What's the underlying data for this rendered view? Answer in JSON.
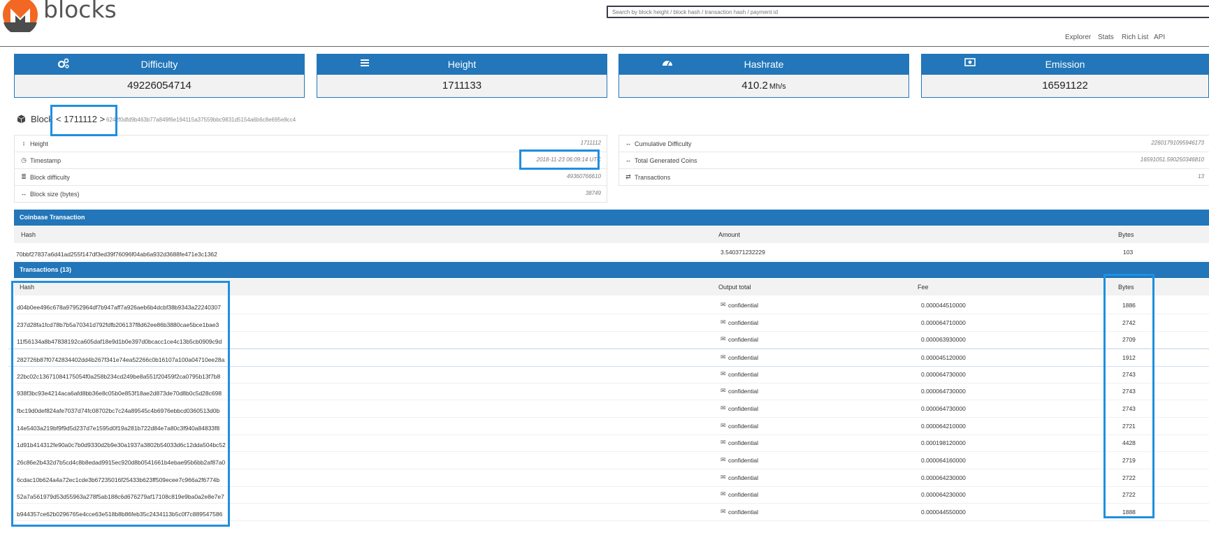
{
  "header": {
    "logo_text": "blocks",
    "search_placeholder": "Search by block height / block hash / transaction hash / payment id",
    "nav": [
      "Explorer",
      "Stats",
      "Rich List",
      "API"
    ]
  },
  "stats": [
    {
      "label": "Difficulty",
      "value": "49226054714",
      "unit": "",
      "icon": "gears-icon"
    },
    {
      "label": "Height",
      "value": "1711133",
      "unit": "",
      "icon": "bars-icon"
    },
    {
      "label": "Hashrate",
      "value": "410.2",
      "unit": "Mh/s",
      "icon": "dashboard-icon"
    },
    {
      "label": "Emission",
      "value": "16591122",
      "unit": "",
      "icon": "money-icon"
    }
  ],
  "block": {
    "label": "Block",
    "prev": "<",
    "number": "1711112",
    "next": ">",
    "hash": "6242f0dfd9b463b77a849f6e194115a37559bbc9831d5154a6b6c8e695e8cc4"
  },
  "info_left": [
    {
      "label": "Height",
      "value": "1711112",
      "icon": "vertical-arrows-icon"
    },
    {
      "label": "Timestamp",
      "value": "2018-11-23 06:09:14 UTC",
      "icon": "clock-icon"
    },
    {
      "label": "Block difficulty",
      "value": "49360766610",
      "icon": "database-icon"
    },
    {
      "label": "Block size (bytes)",
      "value": "38749",
      "icon": "horizontal-arrows-icon"
    }
  ],
  "info_right": [
    {
      "label": "Cumulative Difficulty",
      "value": "22601791095946173",
      "icon": "horizontal-arrows-icon"
    },
    {
      "label": "Total Generated Coins",
      "value": "16591051.590250346810",
      "icon": "horizontal-arrows-icon"
    },
    {
      "label": "Transactions",
      "value": "13",
      "icon": "exchange-icon"
    }
  ],
  "coinbase": {
    "title": "Coinbase Transaction",
    "headers": {
      "hash": "Hash",
      "amount": "Amount",
      "bytes": "Bytes"
    },
    "row": {
      "hash": "70bbf27837a6d41ad255f147df3ed39f76096f04ab6a932d3688fe471e3c1362",
      "amount": "3.540371232229",
      "bytes": "103"
    }
  },
  "transactions": {
    "title": "Transactions (13)",
    "headers": {
      "hash": "Hash",
      "output": "Output total",
      "fee": "Fee",
      "bytes": "Bytes"
    },
    "rows": [
      {
        "hash": "d04b0ee496c678a97952964df7b947aff7a926aeb6b4dcbf38b9343a22240307",
        "output": "confidential",
        "fee": "0.000044510000",
        "bytes": "1886"
      },
      {
        "hash": "237d28fa1fcd78b7b5a70341d792fdfb206137f8d62ee86b3880cae5bce1bae3",
        "output": "confidential",
        "fee": "0.000064710000",
        "bytes": "2742"
      },
      {
        "hash": "11f56134a8b47838192ca605daf18e9d1b0e397d0bcacc1ce4c13b5cb0909c9d",
        "output": "confidential",
        "fee": "0.000063930000",
        "bytes": "2709"
      },
      {
        "hash": "282726b87f0742834402dd4b267f341e74ea52266c0b16107a100a04710ee28a",
        "output": "confidential",
        "fee": "0.000045120000",
        "bytes": "1912"
      },
      {
        "hash": "22bc02c13671084175054f0a258b234cd249be8a551f20459f2ca0795b13f7b8",
        "output": "confidential",
        "fee": "0.000064730000",
        "bytes": "2743"
      },
      {
        "hash": "938f3bc93e4214aca6afd8bb36e8c05b0e853f18ae2d873de70d8b0c5d28c698",
        "output": "confidential",
        "fee": "0.000064730000",
        "bytes": "2743"
      },
      {
        "hash": "fbc19d0def824afe7037d74fc08702bc7c24a89545c4b6976ebbcd0360513d0b",
        "output": "confidential",
        "fee": "0.000064730000",
        "bytes": "2743"
      },
      {
        "hash": "14e5403a219bf9f9d5d237d7e1595d0f19a281b722d84e7a80c3f940a84833f8",
        "output": "confidential",
        "fee": "0.000064210000",
        "bytes": "2721"
      },
      {
        "hash": "1d91b414312fe90a0c7b0d9330d2b9e30a1937a3802b54033d6c12dda504bc52",
        "output": "confidential",
        "fee": "0.000198120000",
        "bytes": "4428"
      },
      {
        "hash": "26c86e2b432d7b5cd4c8b8edad9915ec920d8b0541661b4ebae95b6bb2af87a0",
        "output": "confidential",
        "fee": "0.000064160000",
        "bytes": "2719"
      },
      {
        "hash": "6cdac10b624a4a72ec1cde3b67235016f25433b623ff509ecee7c966a2f6774b",
        "output": "confidential",
        "fee": "0.000064230000",
        "bytes": "2722"
      },
      {
        "hash": "52a7a561979d53d55963a278f5ab188c6d676279af17108c819e9ba0a2e8e7e7",
        "output": "confidential",
        "fee": "0.000064230000",
        "bytes": "2722"
      },
      {
        "hash": "b944357ce62b0296765e4cce63e518b8b86feb35c2434113b5c0f7c889547586",
        "output": "confidential",
        "fee": "0.000044550000",
        "bytes": "1888"
      }
    ]
  },
  "colors": {
    "accent": "#2276b9",
    "annotation": "#1f8fe0",
    "logo_orange": "#f26822",
    "logo_gray": "#4c4c4c"
  }
}
